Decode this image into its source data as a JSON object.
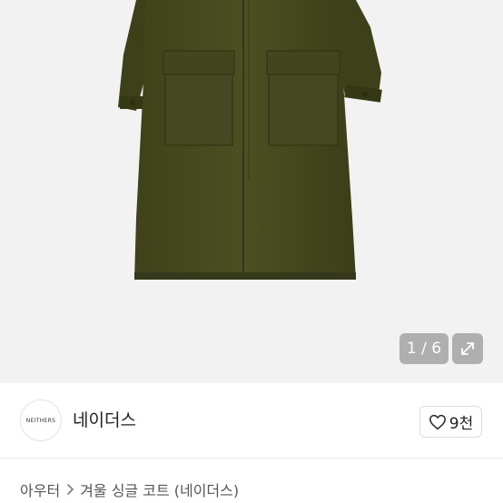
{
  "gallery": {
    "counter": "1 / 6",
    "expand_icon": "expand-arrows-icon",
    "image_subject": "olive-green-wool-coat"
  },
  "seller": {
    "avatar_text": "NEITHERS",
    "name": "네이더스"
  },
  "like": {
    "icon": "heart-outline-icon",
    "count": "9천"
  },
  "breadcrumb": {
    "category": "아우터",
    "separator_icon": "chevron-right-icon",
    "title": "겨울 싱글 코트 (네이더스)"
  },
  "colors": {
    "coat": "#4a4d1f",
    "background": "#f2f2f2",
    "overlay": "#7a7a7a"
  }
}
